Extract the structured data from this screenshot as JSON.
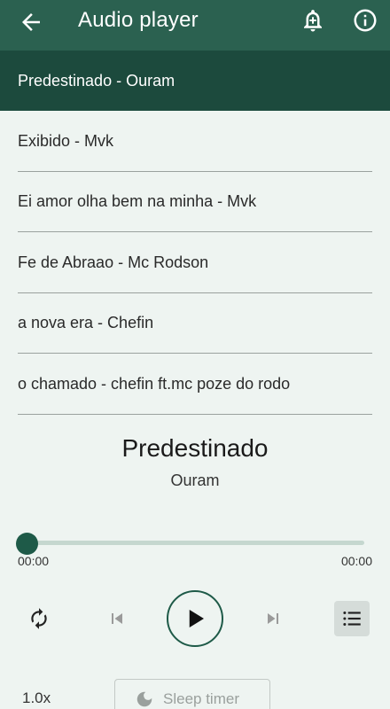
{
  "appbar": {
    "title": "Audio player",
    "back_icon": "arrow-back-icon",
    "bell_icon": "notification-add-icon",
    "info_icon": "info-icon"
  },
  "playlist": {
    "items": [
      {
        "label": "Predestinado - Ouram",
        "active": true
      },
      {
        "label": "Exibido - Mvk",
        "active": false
      },
      {
        "label": "Ei amor olha bem na minha - Mvk",
        "active": false
      },
      {
        "label": "Fe de Abraao - Mc Rodson",
        "active": false
      },
      {
        "label": "a nova era - Chefin",
        "active": false
      },
      {
        "label": "o chamado - chefin ft.mc poze do rodo",
        "active": false
      }
    ]
  },
  "now_playing": {
    "title": "Predestinado",
    "artist": "Ouram",
    "progress": 0,
    "current_time": "00:00",
    "duration": "00:00"
  },
  "controls": {
    "repeat_icon": "repeat-icon",
    "previous_icon": "skip-previous-icon",
    "play_icon": "play-icon",
    "next_icon": "skip-next-icon",
    "queue_icon": "queue-list-icon"
  },
  "footer": {
    "speed": "1.0x",
    "sleep_timer_label": "Sleep timer",
    "sleep_icon": "moon-icon"
  },
  "colors": {
    "appbar": "#2b6150",
    "active_item": "#1c4a3d",
    "accent": "#1e5a48",
    "background": "#eef4f1"
  }
}
